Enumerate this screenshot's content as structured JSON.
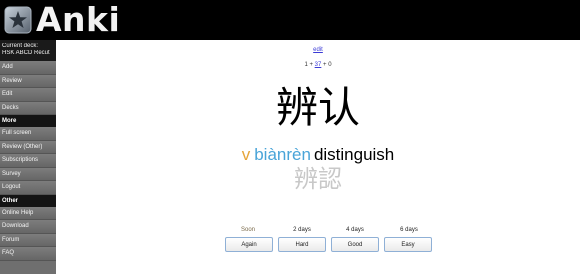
{
  "app": {
    "title": "Anki"
  },
  "sidebar": {
    "current_deck_label": "Current deck:",
    "current_deck_name": "HSK ABCD Recut",
    "items": [
      {
        "label": "Add"
      },
      {
        "label": "Review"
      },
      {
        "label": "Edit"
      },
      {
        "label": "Decks"
      }
    ],
    "more_header": "More",
    "more_items": [
      {
        "label": "Full screen"
      },
      {
        "label": "Review (Other)"
      },
      {
        "label": "Subscriptions"
      },
      {
        "label": "Survey"
      },
      {
        "label": "Logout"
      }
    ],
    "other_header": "Other",
    "other_items": [
      {
        "label": "Online Help"
      },
      {
        "label": "Download"
      },
      {
        "label": "Forum"
      },
      {
        "label": "FAQ"
      }
    ]
  },
  "card": {
    "edit_label": "edit",
    "stats": {
      "new": "1",
      "sep1": " + ",
      "review": "37",
      "sep2": " + ",
      "learning": "0"
    },
    "question": "辨认",
    "answer": {
      "pos": "v",
      "pinyin": "biànrèn",
      "meaning": "distinguish",
      "traditional": "辨認"
    }
  },
  "ease": {
    "intervals": [
      "Soon",
      "2 days",
      "4 days",
      "6 days"
    ],
    "buttons": [
      "Again",
      "Hard",
      "Good",
      "Easy"
    ]
  },
  "colors": {
    "topbar": "#000000",
    "sidebar": "#6f6f6f",
    "pos": "#e6a53a",
    "pinyin": "#49a4d8",
    "link": "#3b3bd6"
  }
}
